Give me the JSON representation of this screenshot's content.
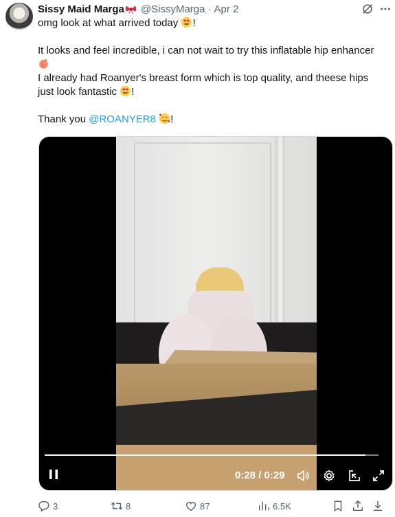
{
  "author": {
    "name": "Sissy Maid Marga",
    "handle": "@SissyMarga",
    "separator": "·",
    "date": "Apr 2"
  },
  "tweet": {
    "line1": "omg look at what arrived today ",
    "line1_end": "!",
    "line2": "It looks and feel incredible, i can not wait to try this inflatable hip enhancer",
    "line3": "I already had Roanyer's breast form which is top quality, and theese hips",
    "line4": "just look fantastic ",
    "line4_end": "!",
    "line5_prefix": "Thank you ",
    "mention": "@ROANYER8",
    "line5_end": "!"
  },
  "video": {
    "current_time": "0:28",
    "time_separator": " / ",
    "duration": "0:29",
    "progress": 0.96
  },
  "actions": {
    "replies": "3",
    "reposts": "8",
    "likes": "87",
    "views": "6.5K"
  },
  "icons": {
    "bow": "bow-emoji",
    "heart_eyes": "heart-eyes-emoji",
    "peach": "peach-emoji",
    "smiling_hearts": "smiling-face-with-hearts-emoji",
    "grok": "grok-icon",
    "more": "more-icon",
    "reply": "reply-icon",
    "repost": "repost-icon",
    "like": "like-icon",
    "views": "views-icon",
    "bookmark": "bookmark-icon",
    "share": "share-icon",
    "download": "download-icon"
  },
  "colors": {
    "text": "#0f1419",
    "secondary": "#536471",
    "link": "#1d9bf0"
  }
}
